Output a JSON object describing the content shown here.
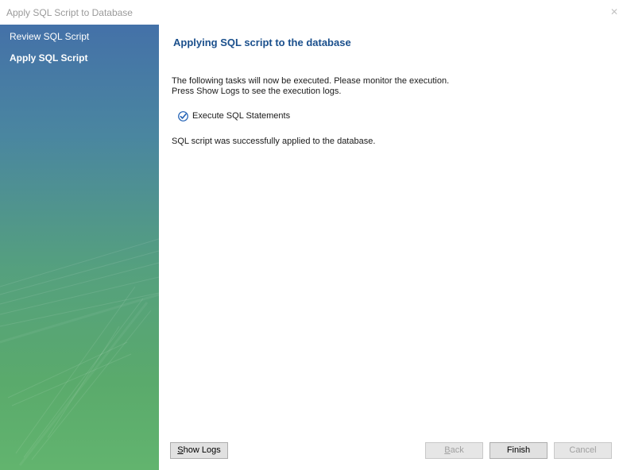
{
  "window": {
    "title": "Apply SQL Script to Database"
  },
  "sidebar": {
    "items": [
      {
        "label": "Review SQL Script",
        "active": false
      },
      {
        "label": "Apply SQL Script",
        "active": true
      }
    ]
  },
  "main": {
    "title": "Applying SQL script to the database",
    "description_line1": "The following tasks will now be executed. Please monitor the execution.",
    "description_line2": "Press Show Logs to see the execution logs.",
    "tasks": [
      {
        "label": "Execute SQL Statements",
        "done": true
      }
    ],
    "status": "SQL script was successfully applied to the database."
  },
  "buttons": {
    "show_logs_first": "S",
    "show_logs_rest": "how Logs",
    "back_first": "B",
    "back_rest": "ack",
    "finish": "Finish",
    "cancel": "Cancel"
  },
  "colors": {
    "title_blue": "#1a4f8c",
    "sidebar_top": "#4471a8",
    "sidebar_bottom": "#62b46e",
    "check_blue": "#1e5fb4"
  }
}
